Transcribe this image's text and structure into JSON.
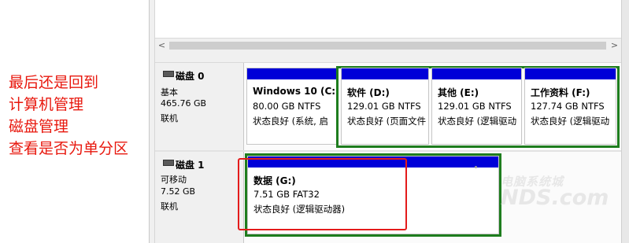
{
  "annotation": {
    "lines": [
      "最后还是回到",
      "计算机管理",
      "磁盘管理",
      "查看是否为单分区"
    ],
    "color": "#e8180e"
  },
  "scrollbar": {
    "left_arrow": "<",
    "right_arrow": ">"
  },
  "disks": [
    {
      "title": "磁盘 0",
      "type": "基本",
      "size": "465.76 GB",
      "status": "联机",
      "partitions": [
        {
          "name": "Windows 10  (C:",
          "size": "80.00 GB NTFS",
          "status": "状态良好 (系统, 启"
        },
        {
          "name": "软件   (D:)",
          "size": "129.01 GB NTFS",
          "status": "状态良好 (页面文件"
        },
        {
          "name": "其他    (E:)",
          "size": "129.01 GB NTFS",
          "status": "状态良好 (逻辑驱动"
        },
        {
          "name": "工作资料  (F:)",
          "size": "127.74 GB NTFS",
          "status": "状态良好 (逻辑驱动"
        }
      ]
    },
    {
      "title": "磁盘 1",
      "type": "可移动",
      "size": "7.52 GB",
      "status": "联机",
      "partitions": [
        {
          "name": "数据  (G:)",
          "size": "7.51 GB FAT32",
          "status": "状态良好 (逻辑驱动器)"
        }
      ]
    }
  ],
  "colors": {
    "primary_partition_bar": "#0000d8",
    "logical_frame": "#1e7d1e",
    "highlight_box": "#e41b1b"
  },
  "watermark": {
    "line1": "电脑系统城",
    "line2": "NDS.com"
  }
}
